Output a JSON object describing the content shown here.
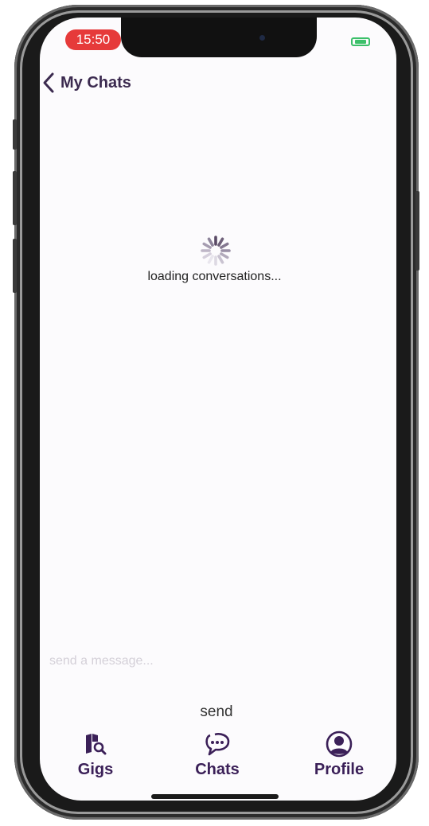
{
  "status_bar": {
    "time": "15:50",
    "battery_color": "#3cc06a",
    "time_pill_color": "#e63a3a"
  },
  "header": {
    "back_icon": "chevron-left-icon",
    "title": "My Chats"
  },
  "loading": {
    "text": "loading conversations..."
  },
  "composer": {
    "placeholder": "send a message...",
    "value": "",
    "send_label": "send"
  },
  "tab_bar": {
    "accent": "#3b2058",
    "tabs": [
      {
        "label": "Gigs",
        "icon": "map-search-icon"
      },
      {
        "label": "Chats",
        "icon": "chat-bubble-icon"
      },
      {
        "label": "Profile",
        "icon": "user-circle-icon"
      }
    ]
  }
}
